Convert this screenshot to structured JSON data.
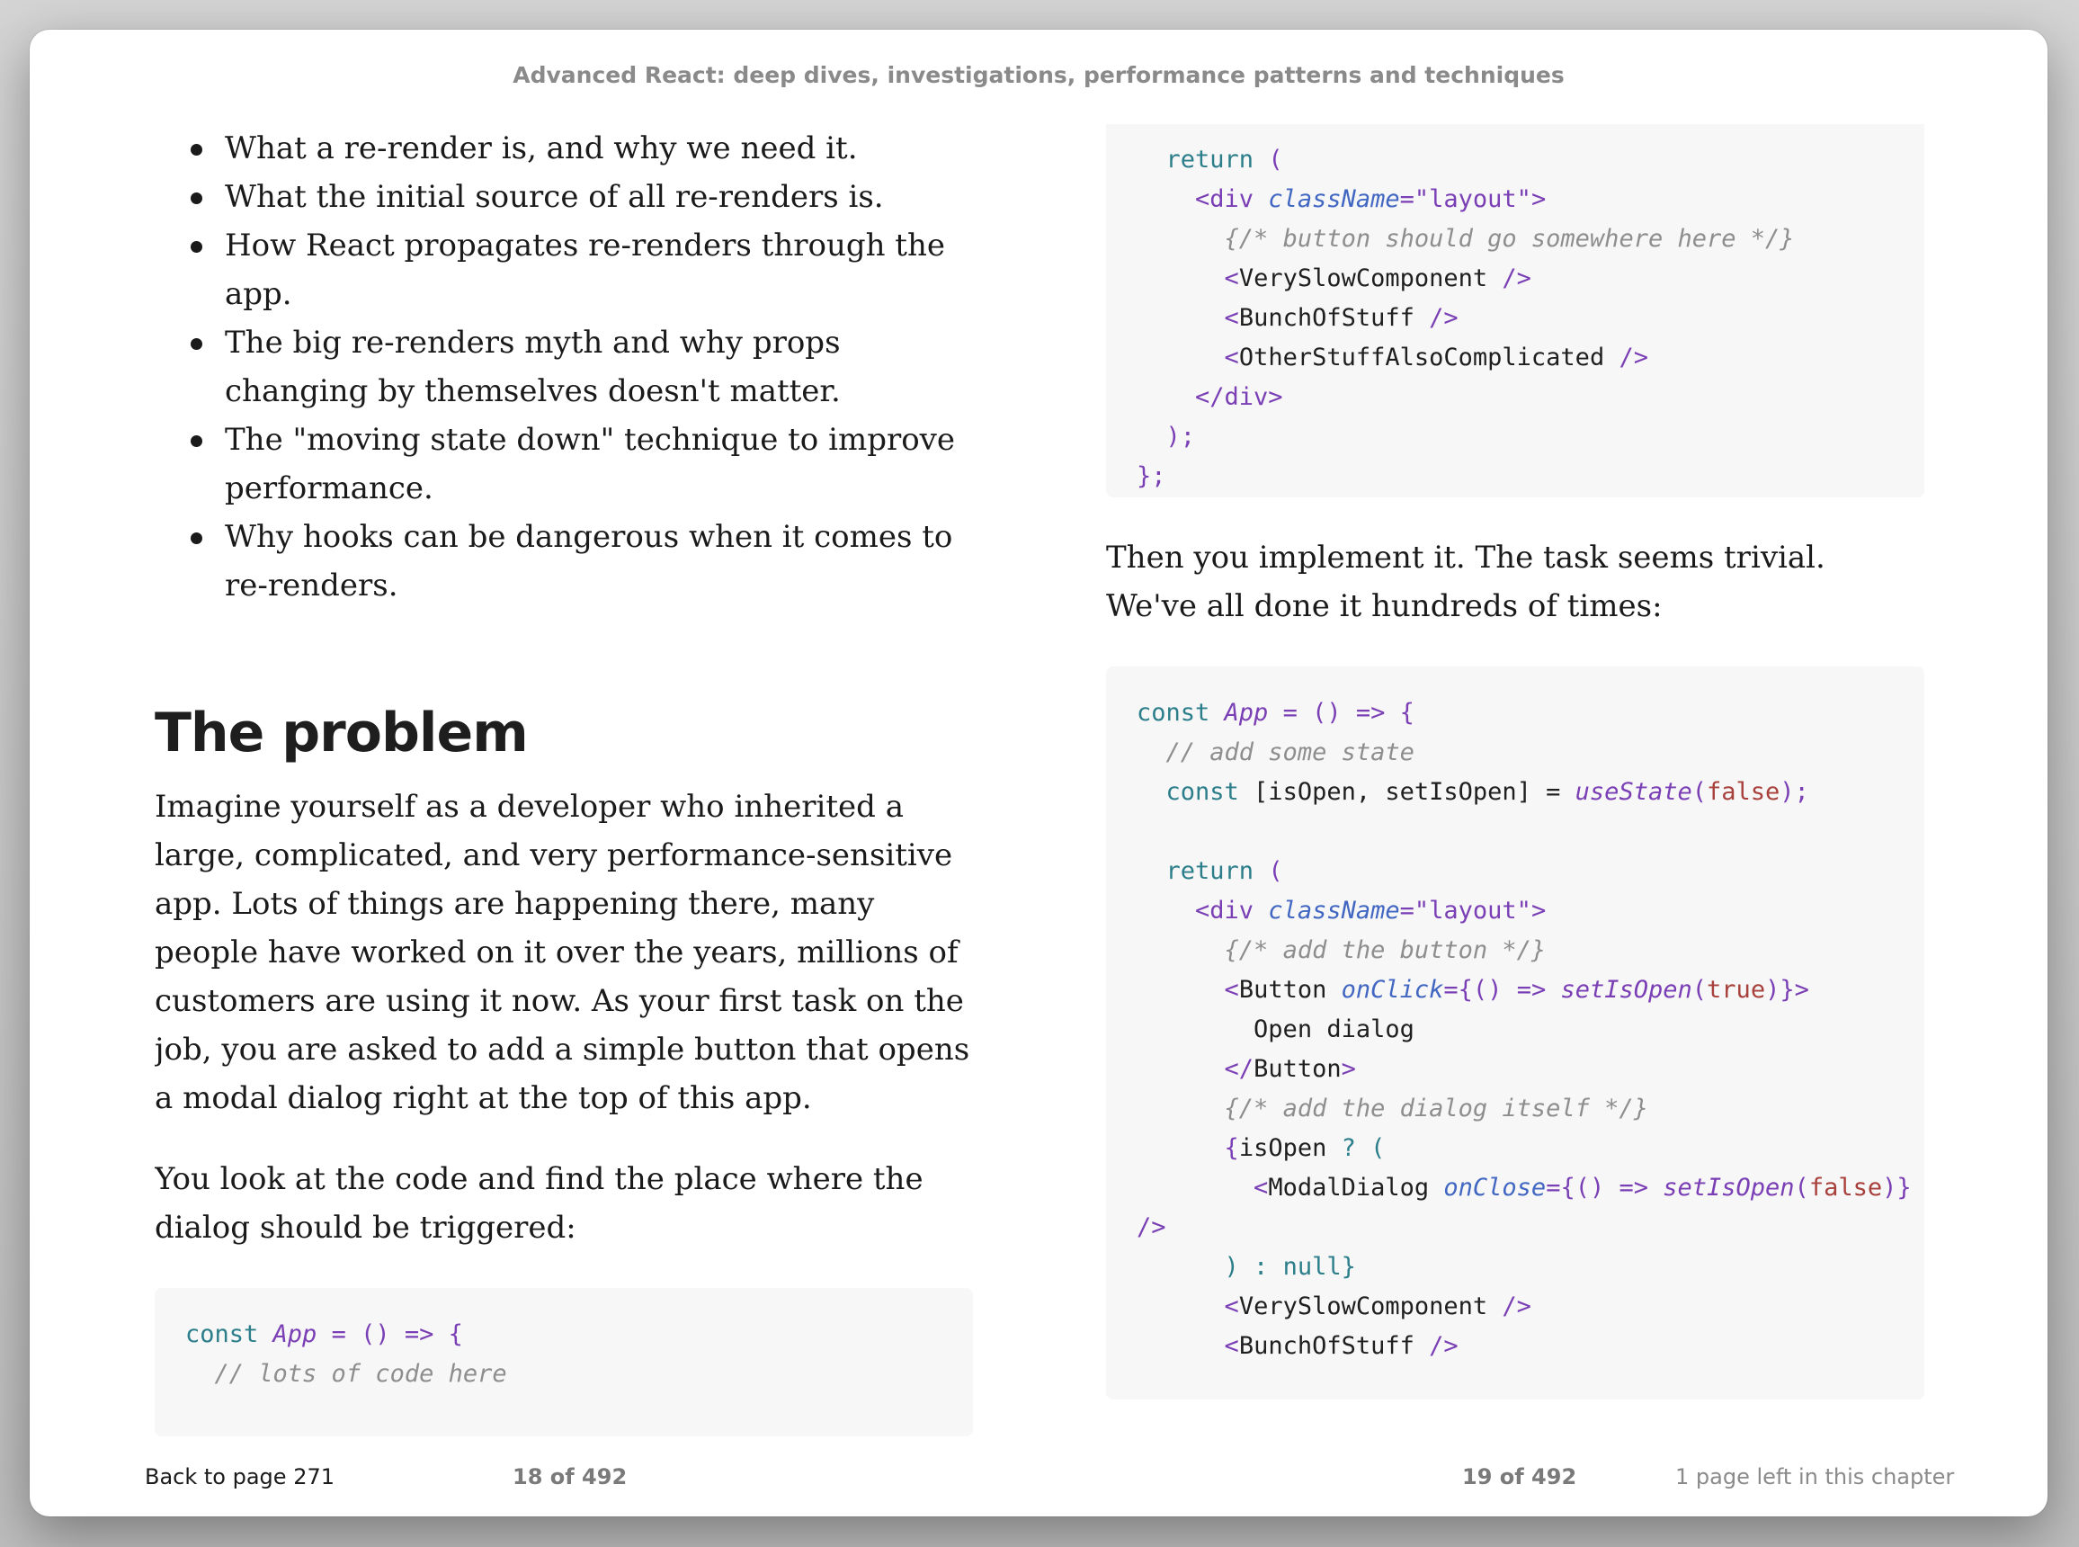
{
  "book": {
    "title": "Advanced React: deep dives, investigations, performance patterns and techniques"
  },
  "left_page": {
    "bullets": [
      "What a re-render is, and why we need it.",
      "What the initial source of all re-renders is.",
      "How React propagates re-renders through the app.",
      "The big re-renders myth and why props changing by themselves doesn't matter.",
      "The \"moving state down\" technique to improve performance.",
      "Why hooks can be dangerous when it comes to re-renders."
    ],
    "heading": "The problem",
    "paragraphs": [
      "Imagine yourself as a developer who inherited a large, complicated, and very performance-sensitive app. Lots of things are happening there, many people have worked on it over the years, millions of customers are using it now. As your first task on the job, you are asked to add a simple button that opens a modal dialog right at the top of this app.",
      "You look at the code and find the place where the dialog should be triggered:"
    ],
    "code": {
      "line1": {
        "kw": "const",
        "name": "App",
        "rest": " = () => {"
      },
      "line2": "// lots of code here"
    }
  },
  "right_page": {
    "code_top": {
      "l1_kw": "return",
      "l1_rest": " (",
      "l2_tag": "<div",
      "l2_attr": "className",
      "l2_val": "=\"layout\">",
      "l3": "{/* button should go somewhere here */}",
      "l4_name": "VerySlowComponent",
      "l5_name": "BunchOfStuff",
      "l6_name": "OtherStuffAlsoComplicated",
      "l7": "</div>",
      "l8": ");",
      "l9": "};"
    },
    "paragraph": "Then you implement it. The task seems trivial. We've all done it hundreds of times:",
    "code_bottom": {
      "l1_kw": "const",
      "l1_name": "App",
      "l1_rest": " = () => {",
      "l2": "// add some state",
      "l3_kw": "const",
      "l3_vars": " [isOpen, setIsOpen] = ",
      "l3_fn": "useState",
      "l3_arg": "false",
      "l4_kw": "return",
      "l4_rest": " (",
      "l5_tag": "<div",
      "l5_attr": "className",
      "l5_val": "=\"layout\">",
      "l6": "{/* add the button */}",
      "l7_name": "Button",
      "l7_attr": "onClick",
      "l7_fn": "setIsOpen",
      "l7_arg": "true",
      "l8": "Open dialog",
      "l9_name": "Button",
      "l10": "{/* add the dialog itself */}",
      "l11": "isOpen",
      "l12_name": "ModalDialog",
      "l12_attr": "onClose",
      "l12_fn": "setIsOpen",
      "l12_arg": "false",
      "l13": "/>",
      "l14": ") : null}",
      "l15_name": "VerySlowComponent",
      "l16_name": "BunchOfStuff"
    }
  },
  "footer": {
    "back_link": "Back to page 271",
    "left_page_number": "18 of 492",
    "right_page_number": "19 of 492",
    "chapter_remaining": "1 page left in this chapter"
  }
}
